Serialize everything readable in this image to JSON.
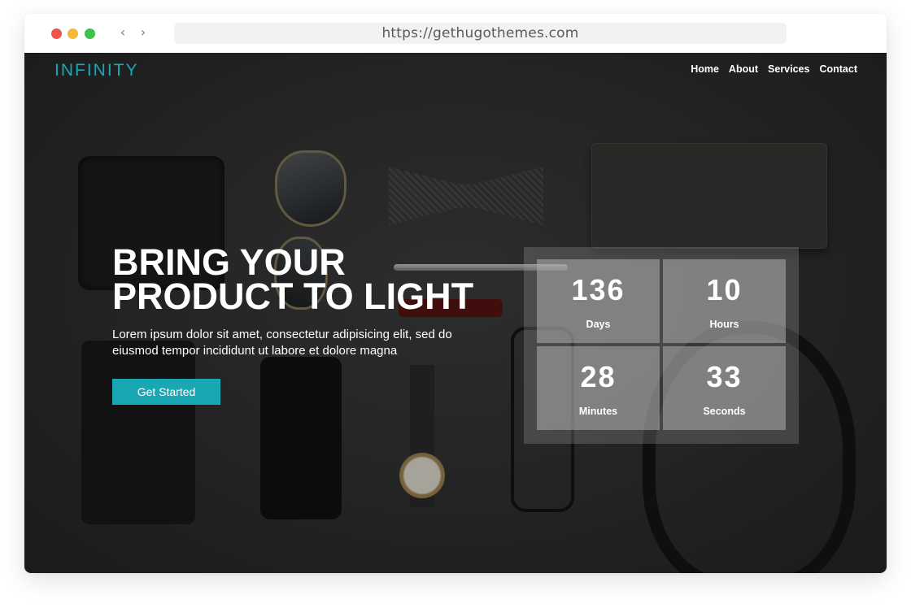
{
  "browser": {
    "url": "https://gethugothemes.com",
    "back_icon": "‹",
    "forward_icon": "›"
  },
  "site": {
    "logo": "INFINITY",
    "nav": [
      "Home",
      "About",
      "Services",
      "Contact"
    ],
    "accent_color": "#1aa7b4"
  },
  "hero": {
    "title_line1": "BRING YOUR",
    "title_line2": "PRODUCT TO LIGHT",
    "subtitle_line1": "Lorem ipsum dolor sit amet, consectetur adipisicing elit, sed do",
    "subtitle_line2": "eiusmod tempor incididunt ut labore et dolore magna",
    "cta_label": "Get Started"
  },
  "countdown": [
    {
      "value": "136",
      "label": "Days"
    },
    {
      "value": "10",
      "label": "Hours"
    },
    {
      "value": "28",
      "label": "Minutes"
    },
    {
      "value": "33",
      "label": "Seconds"
    }
  ]
}
